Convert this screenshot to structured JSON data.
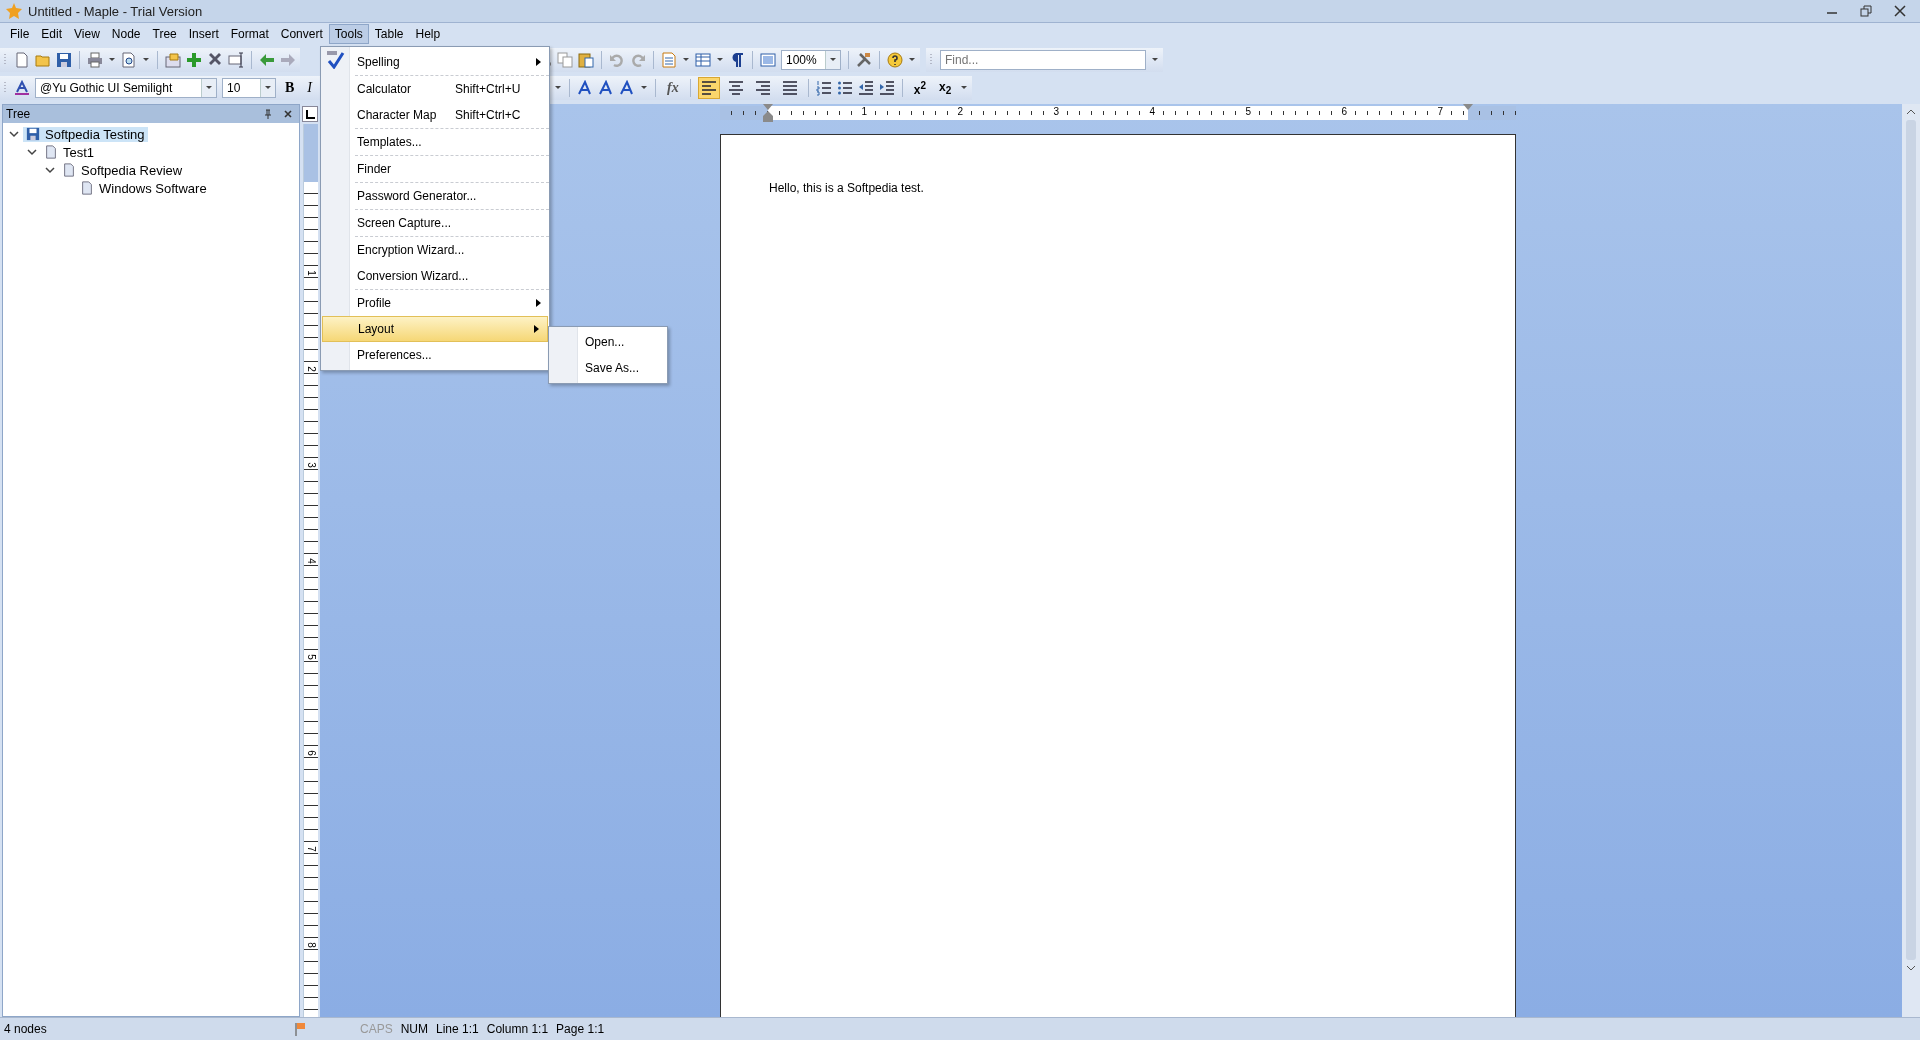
{
  "window": {
    "title": "Untitled - Maple - Trial Version"
  },
  "menu_bar": [
    {
      "label": "File",
      "selected": false
    },
    {
      "label": "Edit",
      "selected": false
    },
    {
      "label": "View",
      "selected": false
    },
    {
      "label": "Node",
      "selected": false
    },
    {
      "label": "Tree",
      "selected": false
    },
    {
      "label": "Insert",
      "selected": false
    },
    {
      "label": "Format",
      "selected": false
    },
    {
      "label": "Convert",
      "selected": false
    },
    {
      "label": "Tools",
      "selected": true
    },
    {
      "label": "Table",
      "selected": false
    },
    {
      "label": "Help",
      "selected": false
    }
  ],
  "toolbar": {
    "font": "@Yu Gothic UI Semilight",
    "font_size": "10",
    "zoom": "100%",
    "find_placeholder": "Find...",
    "text_style_buttons": [
      "B",
      "I"
    ],
    "formula_button": "fx",
    "script_buttons": [
      "x$^{2}$",
      "x$_{2}$"
    ],
    "align_buttons": [
      {
        "kind": "left",
        "selected": true
      },
      {
        "kind": "center",
        "selected": false
      },
      {
        "kind": "right",
        "selected": false
      },
      {
        "kind": "justify",
        "selected": false
      }
    ]
  },
  "tree_panel": {
    "title": "Tree",
    "nodes": [
      {
        "label": "Softpedia Testing",
        "kind": "file",
        "selected": true,
        "expanded": true,
        "children": [
          {
            "label": "Test1",
            "kind": "page",
            "selected": false,
            "expanded": true,
            "children": [
              {
                "label": "Softpedia Review",
                "kind": "page",
                "selected": false,
                "expanded": true,
                "children": [
                  {
                    "label": "Windows Software",
                    "kind": "page",
                    "selected": false
                  }
                ]
              }
            ]
          }
        ]
      }
    ]
  },
  "ruler": {
    "horizontal_labels": [
      "1",
      "2",
      "3",
      "4",
      "5",
      "6",
      "7"
    ],
    "vertical_labels": [
      "1",
      "2",
      "3",
      "4",
      "5",
      "6",
      "7",
      "8"
    ]
  },
  "document": {
    "text": "Hello, this is a Softpedia test."
  },
  "tools_menu": {
    "groups": [
      [
        {
          "label": "Spelling",
          "has_submenu": true,
          "selected": false
        }
      ],
      [
        {
          "label": "Calculator",
          "shortcut": "Shift+Ctrl+U",
          "has_submenu": false,
          "selected": false
        },
        {
          "label": "Character Map",
          "shortcut": "Shift+Ctrl+C",
          "has_submenu": false,
          "selected": false
        }
      ],
      [
        {
          "label": "Templates...",
          "has_submenu": false,
          "selected": false
        }
      ],
      [
        {
          "label": "Finder",
          "has_submenu": false,
          "selected": false
        }
      ],
      [
        {
          "label": "Password Generator...",
          "has_submenu": false,
          "selected": false
        }
      ],
      [
        {
          "label": "Screen Capture...",
          "has_submenu": false,
          "selected": false
        }
      ],
      [
        {
          "label": "Encryption Wizard...",
          "has_submenu": false,
          "selected": false
        },
        {
          "label": "Conversion Wizard...",
          "has_submenu": false,
          "selected": false
        }
      ],
      [
        {
          "label": "Profile",
          "has_submenu": true,
          "selected": false
        },
        {
          "label": "Layout",
          "has_submenu": true,
          "selected": true
        },
        {
          "label": "Preferences...",
          "has_submenu": false,
          "selected": false
        }
      ]
    ]
  },
  "layout_submenu": [
    "Open...",
    "Save As..."
  ],
  "status_bar": {
    "node_count": "4 nodes",
    "indicators": [
      {
        "label": "CAPS",
        "on": false
      },
      {
        "label": "NUM",
        "on": true
      }
    ],
    "position": [
      "Line 1:1",
      "Column 1:1",
      "Page 1:1"
    ]
  }
}
